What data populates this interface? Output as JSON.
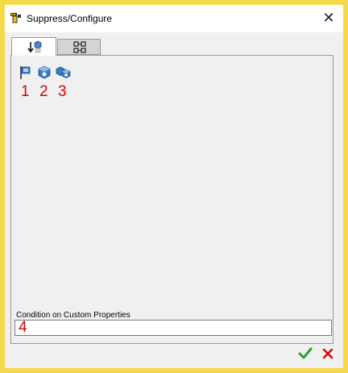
{
  "window": {
    "title": "Suppress/Configure",
    "icon": "suppress-configure-app-icon",
    "close_icon": "close-icon"
  },
  "tabs": [
    {
      "icon": "suppress-tab-icon",
      "active": true
    },
    {
      "icon": "configure-tab-icon",
      "active": false
    }
  ],
  "toolbar": {
    "items": [
      {
        "icon": "feature-flag-icon"
      },
      {
        "icon": "component-icon"
      },
      {
        "icon": "multiple-components-icon"
      }
    ]
  },
  "annotations": [
    "1",
    "2",
    "3",
    "4"
  ],
  "condition": {
    "label": "Condition on Custom Properties",
    "value": ""
  },
  "actions": {
    "ok_icon": "checkmark-icon",
    "cancel_icon": "cancel-x-icon"
  },
  "colors": {
    "border": "#f5d94a",
    "annotation": "#e00000",
    "ok": "#2ca02c",
    "cancel": "#e00000"
  }
}
